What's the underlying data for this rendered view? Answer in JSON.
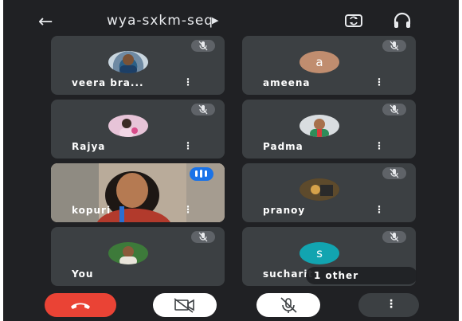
{
  "header": {
    "back_icon": "arrow-left-icon",
    "meeting_code": "wya-sxkm-seq",
    "details_icon": "caret-right-icon",
    "switch_camera_icon": "camera-switch-icon",
    "audio_icon": "headphones-icon"
  },
  "participants": [
    {
      "name": "veera bra...",
      "avatar_type": "photo",
      "muted": true
    },
    {
      "name": "ameena",
      "avatar_type": "letter",
      "initial": "a",
      "avatar_color": "#c08d6f",
      "muted": true
    },
    {
      "name": "Rajya",
      "avatar_type": "photo",
      "muted": true
    },
    {
      "name": "Padma",
      "avatar_type": "photo",
      "muted": true
    },
    {
      "name": "kopuri",
      "avatar_type": "video",
      "speaking": true
    },
    {
      "name": "pranoy",
      "avatar_type": "photo",
      "muted": true
    },
    {
      "name": "You",
      "avatar_type": "photo",
      "muted": true
    },
    {
      "name": "sucharit",
      "avatar_type": "letter",
      "initial": "s",
      "avatar_color": "#12a4b0",
      "muted": true
    }
  ],
  "others_badge": "1 other",
  "more_icon": "more-vertical-icon",
  "controls": {
    "end_call_icon": "phone-hangup-icon",
    "camera_off_icon": "video-off-icon",
    "mic_off_icon": "mic-off-icon",
    "more_icon": "more-vertical-icon"
  },
  "colors": {
    "background": "#202124",
    "tile": "#3c4043",
    "end_call": "#ea4335",
    "speaking": "#1a73e8"
  }
}
